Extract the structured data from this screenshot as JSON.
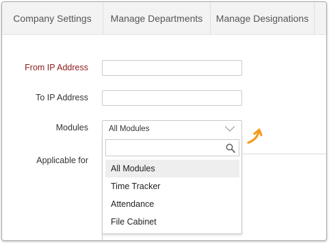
{
  "tabs": [
    {
      "label": "Company Settings"
    },
    {
      "label": "Manage Departments"
    },
    {
      "label": "Manage Designations"
    }
  ],
  "form": {
    "from_ip_label": "From IP Address",
    "from_ip_value": "",
    "to_ip_label": "To IP Address",
    "to_ip_value": "",
    "modules_label": "Modules",
    "modules_selected": "All Modules",
    "applicable_label": "Applicable for"
  },
  "dropdown": {
    "search_value": "",
    "options": [
      {
        "label": "All Modules",
        "selected": true
      },
      {
        "label": "Time Tracker",
        "selected": false
      },
      {
        "label": "Attendance",
        "selected": false
      },
      {
        "label": "File Cabinet",
        "selected": false
      }
    ]
  },
  "colors": {
    "required_label": "#8b1a1a",
    "accent_arrow": "#f39c1e",
    "selected_bg": "#eeeeee",
    "tabbar_bg": "#f3f3f3"
  },
  "icons": {
    "search": "magnifier",
    "chevron": "chevron-down",
    "pointer": "orange-curved-arrow"
  }
}
